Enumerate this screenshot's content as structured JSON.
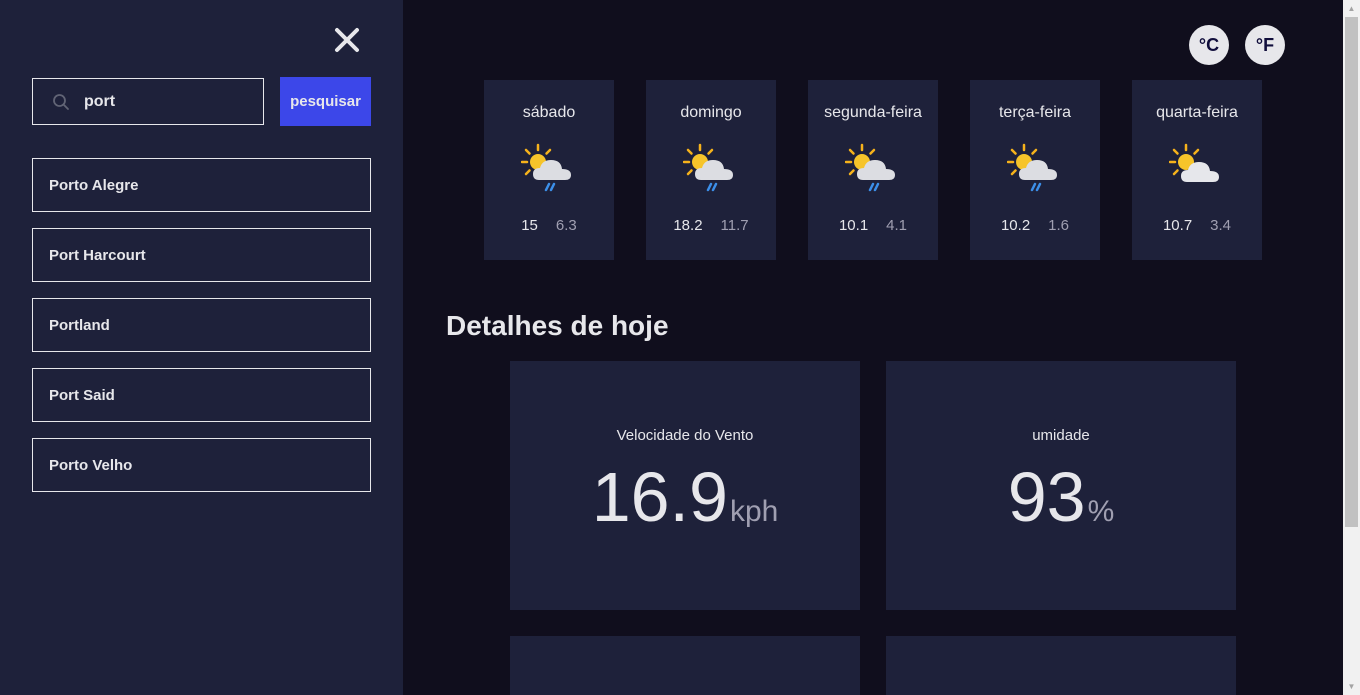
{
  "sidebar": {
    "close_icon": "close-icon",
    "search": {
      "value": "port",
      "placeholder": "search location",
      "icon": "search-icon"
    },
    "search_button_label": "pesquisar",
    "results": [
      {
        "label": "Porto Alegre"
      },
      {
        "label": "Port Harcourt"
      },
      {
        "label": "Portland"
      },
      {
        "label": "Port Said"
      },
      {
        "label": "Porto Velho"
      }
    ]
  },
  "units": {
    "celsius_label": "°C",
    "fahrenheit_label": "°F"
  },
  "forecast": [
    {
      "day": "sábado",
      "icon": "sun-cloud-rain-icon",
      "max": "15",
      "min": "6.3"
    },
    {
      "day": "domingo",
      "icon": "sun-cloud-rain-icon",
      "max": "18.2",
      "min": "11.7"
    },
    {
      "day": "segunda-feira",
      "icon": "sun-cloud-rain-icon",
      "max": "10.1",
      "min": "4.1"
    },
    {
      "day": "terça-feira",
      "icon": "sun-cloud-rain-icon",
      "max": "10.2",
      "min": "1.6"
    },
    {
      "day": "quarta-feira",
      "icon": "sun-cloud-icon",
      "max": "10.7",
      "min": "3.4"
    }
  ],
  "details": {
    "title": "Detalhes de hoje",
    "cards": [
      {
        "label": "Velocidade do Vento",
        "value": "16.9",
        "unit": "kph"
      },
      {
        "label": "umidade",
        "value": "93",
        "unit": "%"
      }
    ]
  },
  "colors": {
    "sidebar_bg": "#1e213a",
    "main_bg": "#100e1d",
    "accent": "#3c47e9",
    "text": "#e7e7eb",
    "muted": "#a09fb1"
  }
}
